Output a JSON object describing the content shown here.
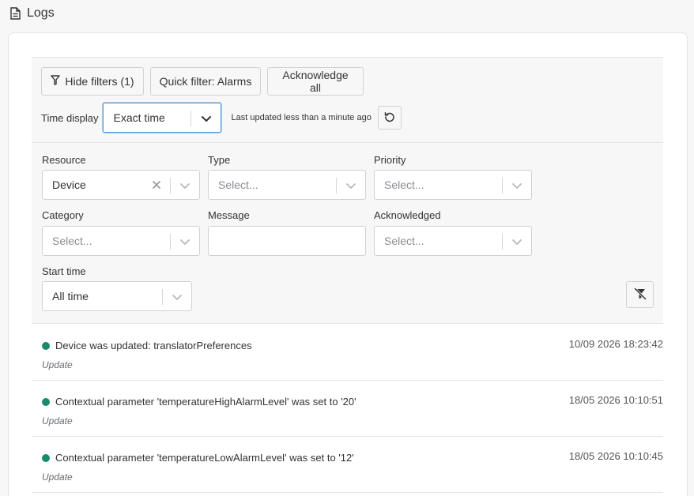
{
  "page": {
    "title": "Logs",
    "icon": "document-icon"
  },
  "toolbar": {
    "hide_filters": "Hide filters (1)",
    "quick_filter": "Quick filter: Alarms",
    "acknowledge_all": "Acknowledge all"
  },
  "time_display": {
    "label": "Time display",
    "value": "Exact time",
    "last_updated": "Last updated less than a minute ago"
  },
  "filters": {
    "resource": {
      "label": "Resource",
      "value": "Device"
    },
    "type": {
      "label": "Type",
      "placeholder": "Select..."
    },
    "priority": {
      "label": "Priority",
      "placeholder": "Select..."
    },
    "category": {
      "label": "Category",
      "placeholder": "Select..."
    },
    "message": {
      "label": "Message",
      "value": ""
    },
    "acknowledged": {
      "label": "Acknowledged",
      "placeholder": "Select..."
    },
    "start_time": {
      "label": "Start time",
      "value": "All time"
    }
  },
  "logs": [
    {
      "message": "Device was updated: translatorPreferences",
      "type": "Update",
      "time": "10/09 2026 18:23:42"
    },
    {
      "message": "Contextual parameter 'temperatureHighAlarmLevel' was set to '20'",
      "type": "Update",
      "time": "18/05 2026 10:10:51"
    },
    {
      "message": "Contextual parameter 'temperatureLowAlarmLevel' was set to '12'",
      "type": "Update",
      "time": "18/05 2026 10:10:45"
    }
  ],
  "colors": {
    "status_ok": "#1a8a6e",
    "focus_border": "#5b9bd5"
  }
}
